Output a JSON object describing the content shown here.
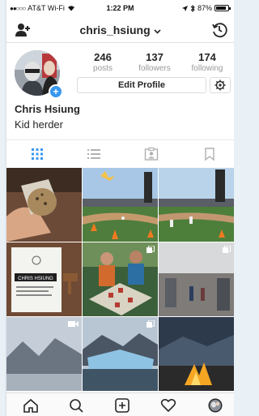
{
  "status_bar": {
    "carrier": "AT&T Wi-Fi",
    "time": "1:22 PM",
    "battery": "87%"
  },
  "header": {
    "username": "chris_hsiung",
    "left_icon": "add-user-icon",
    "right_icon": "history-icon"
  },
  "profile": {
    "posts_count": "246",
    "posts_label": "posts",
    "followers_count": "137",
    "followers_label": "followers",
    "following_count": "174",
    "following_label": "following",
    "edit_label": "Edit Profile",
    "name": "Chris Hsiung",
    "bio": "Kid herder"
  },
  "tabs": [
    "grid-icon",
    "list-icon",
    "tagged-icon",
    "saved-icon"
  ],
  "grid": {
    "photo_5_caption": "CHRIS HSIUNG"
  },
  "bottom_nav": [
    "home-icon",
    "search-icon",
    "new-post-icon",
    "activity-icon",
    "profile-icon"
  ],
  "colors": {
    "accent": "#3897f0",
    "text": "#262626",
    "muted": "#999999",
    "border": "#dbdbdb"
  }
}
